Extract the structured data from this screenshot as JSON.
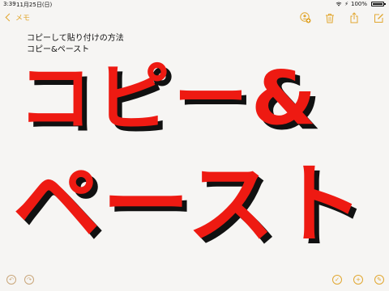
{
  "status_bar": {
    "time": "3:39",
    "date": "11月25日(日)",
    "battery_percent": "100%",
    "battery_level": 1.0
  },
  "nav": {
    "back_label": "メモ",
    "accent_color": "#e1a730"
  },
  "note": {
    "line1": "コピーして貼り付けの方法",
    "line2": "コピー&ペースト",
    "big_line1": "コピー&",
    "big_line2": "ペースト",
    "big_text_color": "#ee1a12",
    "big_shadow_color": "#111111"
  },
  "icons": {
    "top_right": [
      "add-person-icon",
      "trash-icon",
      "share-icon",
      "compose-icon"
    ],
    "bottom_left": [
      "undo-icon",
      "redo-icon"
    ],
    "bottom_right": [
      "checklist-icon",
      "add-icon",
      "sketch-icon"
    ]
  }
}
